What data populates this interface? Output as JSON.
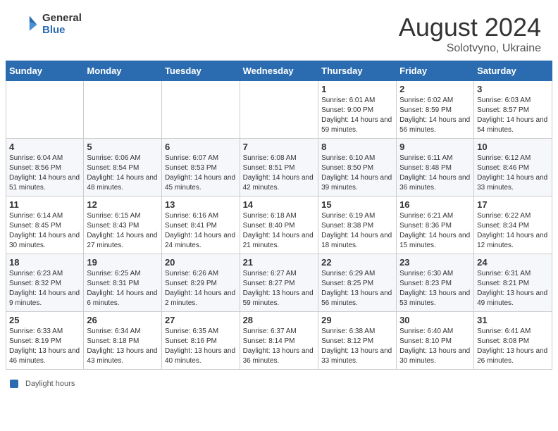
{
  "header": {
    "logo_general": "General",
    "logo_blue": "Blue",
    "month_year": "August 2024",
    "location": "Solotvyno, Ukraine"
  },
  "weekdays": [
    "Sunday",
    "Monday",
    "Tuesday",
    "Wednesday",
    "Thursday",
    "Friday",
    "Saturday"
  ],
  "legend_label": "Daylight hours",
  "weeks": [
    [
      {
        "day": "",
        "sunrise": "",
        "sunset": "",
        "daylight": ""
      },
      {
        "day": "",
        "sunrise": "",
        "sunset": "",
        "daylight": ""
      },
      {
        "day": "",
        "sunrise": "",
        "sunset": "",
        "daylight": ""
      },
      {
        "day": "",
        "sunrise": "",
        "sunset": "",
        "daylight": ""
      },
      {
        "day": "1",
        "sunrise": "Sunrise: 6:01 AM",
        "sunset": "Sunset: 9:00 PM",
        "daylight": "Daylight: 14 hours and 59 minutes."
      },
      {
        "day": "2",
        "sunrise": "Sunrise: 6:02 AM",
        "sunset": "Sunset: 8:59 PM",
        "daylight": "Daylight: 14 hours and 56 minutes."
      },
      {
        "day": "3",
        "sunrise": "Sunrise: 6:03 AM",
        "sunset": "Sunset: 8:57 PM",
        "daylight": "Daylight: 14 hours and 54 minutes."
      }
    ],
    [
      {
        "day": "4",
        "sunrise": "Sunrise: 6:04 AM",
        "sunset": "Sunset: 8:56 PM",
        "daylight": "Daylight: 14 hours and 51 minutes."
      },
      {
        "day": "5",
        "sunrise": "Sunrise: 6:06 AM",
        "sunset": "Sunset: 8:54 PM",
        "daylight": "Daylight: 14 hours and 48 minutes."
      },
      {
        "day": "6",
        "sunrise": "Sunrise: 6:07 AM",
        "sunset": "Sunset: 8:53 PM",
        "daylight": "Daylight: 14 hours and 45 minutes."
      },
      {
        "day": "7",
        "sunrise": "Sunrise: 6:08 AM",
        "sunset": "Sunset: 8:51 PM",
        "daylight": "Daylight: 14 hours and 42 minutes."
      },
      {
        "day": "8",
        "sunrise": "Sunrise: 6:10 AM",
        "sunset": "Sunset: 8:50 PM",
        "daylight": "Daylight: 14 hours and 39 minutes."
      },
      {
        "day": "9",
        "sunrise": "Sunrise: 6:11 AM",
        "sunset": "Sunset: 8:48 PM",
        "daylight": "Daylight: 14 hours and 36 minutes."
      },
      {
        "day": "10",
        "sunrise": "Sunrise: 6:12 AM",
        "sunset": "Sunset: 8:46 PM",
        "daylight": "Daylight: 14 hours and 33 minutes."
      }
    ],
    [
      {
        "day": "11",
        "sunrise": "Sunrise: 6:14 AM",
        "sunset": "Sunset: 8:45 PM",
        "daylight": "Daylight: 14 hours and 30 minutes."
      },
      {
        "day": "12",
        "sunrise": "Sunrise: 6:15 AM",
        "sunset": "Sunset: 8:43 PM",
        "daylight": "Daylight: 14 hours and 27 minutes."
      },
      {
        "day": "13",
        "sunrise": "Sunrise: 6:16 AM",
        "sunset": "Sunset: 8:41 PM",
        "daylight": "Daylight: 14 hours and 24 minutes."
      },
      {
        "day": "14",
        "sunrise": "Sunrise: 6:18 AM",
        "sunset": "Sunset: 8:40 PM",
        "daylight": "Daylight: 14 hours and 21 minutes."
      },
      {
        "day": "15",
        "sunrise": "Sunrise: 6:19 AM",
        "sunset": "Sunset: 8:38 PM",
        "daylight": "Daylight: 14 hours and 18 minutes."
      },
      {
        "day": "16",
        "sunrise": "Sunrise: 6:21 AM",
        "sunset": "Sunset: 8:36 PM",
        "daylight": "Daylight: 14 hours and 15 minutes."
      },
      {
        "day": "17",
        "sunrise": "Sunrise: 6:22 AM",
        "sunset": "Sunset: 8:34 PM",
        "daylight": "Daylight: 14 hours and 12 minutes."
      }
    ],
    [
      {
        "day": "18",
        "sunrise": "Sunrise: 6:23 AM",
        "sunset": "Sunset: 8:32 PM",
        "daylight": "Daylight: 14 hours and 9 minutes."
      },
      {
        "day": "19",
        "sunrise": "Sunrise: 6:25 AM",
        "sunset": "Sunset: 8:31 PM",
        "daylight": "Daylight: 14 hours and 6 minutes."
      },
      {
        "day": "20",
        "sunrise": "Sunrise: 6:26 AM",
        "sunset": "Sunset: 8:29 PM",
        "daylight": "Daylight: 14 hours and 2 minutes."
      },
      {
        "day": "21",
        "sunrise": "Sunrise: 6:27 AM",
        "sunset": "Sunset: 8:27 PM",
        "daylight": "Daylight: 13 hours and 59 minutes."
      },
      {
        "day": "22",
        "sunrise": "Sunrise: 6:29 AM",
        "sunset": "Sunset: 8:25 PM",
        "daylight": "Daylight: 13 hours and 56 minutes."
      },
      {
        "day": "23",
        "sunrise": "Sunrise: 6:30 AM",
        "sunset": "Sunset: 8:23 PM",
        "daylight": "Daylight: 13 hours and 53 minutes."
      },
      {
        "day": "24",
        "sunrise": "Sunrise: 6:31 AM",
        "sunset": "Sunset: 8:21 PM",
        "daylight": "Daylight: 13 hours and 49 minutes."
      }
    ],
    [
      {
        "day": "25",
        "sunrise": "Sunrise: 6:33 AM",
        "sunset": "Sunset: 8:19 PM",
        "daylight": "Daylight: 13 hours and 46 minutes."
      },
      {
        "day": "26",
        "sunrise": "Sunrise: 6:34 AM",
        "sunset": "Sunset: 8:18 PM",
        "daylight": "Daylight: 13 hours and 43 minutes."
      },
      {
        "day": "27",
        "sunrise": "Sunrise: 6:35 AM",
        "sunset": "Sunset: 8:16 PM",
        "daylight": "Daylight: 13 hours and 40 minutes."
      },
      {
        "day": "28",
        "sunrise": "Sunrise: 6:37 AM",
        "sunset": "Sunset: 8:14 PM",
        "daylight": "Daylight: 13 hours and 36 minutes."
      },
      {
        "day": "29",
        "sunrise": "Sunrise: 6:38 AM",
        "sunset": "Sunset: 8:12 PM",
        "daylight": "Daylight: 13 hours and 33 minutes."
      },
      {
        "day": "30",
        "sunrise": "Sunrise: 6:40 AM",
        "sunset": "Sunset: 8:10 PM",
        "daylight": "Daylight: 13 hours and 30 minutes."
      },
      {
        "day": "31",
        "sunrise": "Sunrise: 6:41 AM",
        "sunset": "Sunset: 8:08 PM",
        "daylight": "Daylight: 13 hours and 26 minutes."
      }
    ]
  ]
}
